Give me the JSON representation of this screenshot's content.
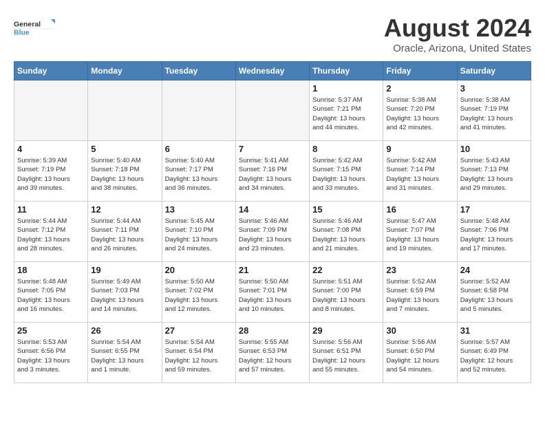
{
  "header": {
    "logo_line1": "General",
    "logo_line2": "Blue",
    "title": "August 2024",
    "subtitle": "Oracle, Arizona, United States"
  },
  "weekdays": [
    "Sunday",
    "Monday",
    "Tuesday",
    "Wednesday",
    "Thursday",
    "Friday",
    "Saturday"
  ],
  "weeks": [
    [
      {
        "day": "",
        "info": ""
      },
      {
        "day": "",
        "info": ""
      },
      {
        "day": "",
        "info": ""
      },
      {
        "day": "",
        "info": ""
      },
      {
        "day": "1",
        "info": "Sunrise: 5:37 AM\nSunset: 7:21 PM\nDaylight: 13 hours\nand 44 minutes."
      },
      {
        "day": "2",
        "info": "Sunrise: 5:38 AM\nSunset: 7:20 PM\nDaylight: 13 hours\nand 42 minutes."
      },
      {
        "day": "3",
        "info": "Sunrise: 5:38 AM\nSunset: 7:19 PM\nDaylight: 13 hours\nand 41 minutes."
      }
    ],
    [
      {
        "day": "4",
        "info": "Sunrise: 5:39 AM\nSunset: 7:19 PM\nDaylight: 13 hours\nand 39 minutes."
      },
      {
        "day": "5",
        "info": "Sunrise: 5:40 AM\nSunset: 7:18 PM\nDaylight: 13 hours\nand 38 minutes."
      },
      {
        "day": "6",
        "info": "Sunrise: 5:40 AM\nSunset: 7:17 PM\nDaylight: 13 hours\nand 36 minutes."
      },
      {
        "day": "7",
        "info": "Sunrise: 5:41 AM\nSunset: 7:16 PM\nDaylight: 13 hours\nand 34 minutes."
      },
      {
        "day": "8",
        "info": "Sunrise: 5:42 AM\nSunset: 7:15 PM\nDaylight: 13 hours\nand 33 minutes."
      },
      {
        "day": "9",
        "info": "Sunrise: 5:42 AM\nSunset: 7:14 PM\nDaylight: 13 hours\nand 31 minutes."
      },
      {
        "day": "10",
        "info": "Sunrise: 5:43 AM\nSunset: 7:13 PM\nDaylight: 13 hours\nand 29 minutes."
      }
    ],
    [
      {
        "day": "11",
        "info": "Sunrise: 5:44 AM\nSunset: 7:12 PM\nDaylight: 13 hours\nand 28 minutes."
      },
      {
        "day": "12",
        "info": "Sunrise: 5:44 AM\nSunset: 7:11 PM\nDaylight: 13 hours\nand 26 minutes."
      },
      {
        "day": "13",
        "info": "Sunrise: 5:45 AM\nSunset: 7:10 PM\nDaylight: 13 hours\nand 24 minutes."
      },
      {
        "day": "14",
        "info": "Sunrise: 5:46 AM\nSunset: 7:09 PM\nDaylight: 13 hours\nand 23 minutes."
      },
      {
        "day": "15",
        "info": "Sunrise: 5:46 AM\nSunset: 7:08 PM\nDaylight: 13 hours\nand 21 minutes."
      },
      {
        "day": "16",
        "info": "Sunrise: 5:47 AM\nSunset: 7:07 PM\nDaylight: 13 hours\nand 19 minutes."
      },
      {
        "day": "17",
        "info": "Sunrise: 5:48 AM\nSunset: 7:06 PM\nDaylight: 13 hours\nand 17 minutes."
      }
    ],
    [
      {
        "day": "18",
        "info": "Sunrise: 5:48 AM\nSunset: 7:05 PM\nDaylight: 13 hours\nand 16 minutes."
      },
      {
        "day": "19",
        "info": "Sunrise: 5:49 AM\nSunset: 7:03 PM\nDaylight: 13 hours\nand 14 minutes."
      },
      {
        "day": "20",
        "info": "Sunrise: 5:50 AM\nSunset: 7:02 PM\nDaylight: 13 hours\nand 12 minutes."
      },
      {
        "day": "21",
        "info": "Sunrise: 5:50 AM\nSunset: 7:01 PM\nDaylight: 13 hours\nand 10 minutes."
      },
      {
        "day": "22",
        "info": "Sunrise: 5:51 AM\nSunset: 7:00 PM\nDaylight: 13 hours\nand 8 minutes."
      },
      {
        "day": "23",
        "info": "Sunrise: 5:52 AM\nSunset: 6:59 PM\nDaylight: 13 hours\nand 7 minutes."
      },
      {
        "day": "24",
        "info": "Sunrise: 5:52 AM\nSunset: 6:58 PM\nDaylight: 13 hours\nand 5 minutes."
      }
    ],
    [
      {
        "day": "25",
        "info": "Sunrise: 5:53 AM\nSunset: 6:56 PM\nDaylight: 13 hours\nand 3 minutes."
      },
      {
        "day": "26",
        "info": "Sunrise: 5:54 AM\nSunset: 6:55 PM\nDaylight: 13 hours\nand 1 minute."
      },
      {
        "day": "27",
        "info": "Sunrise: 5:54 AM\nSunset: 6:54 PM\nDaylight: 12 hours\nand 59 minutes."
      },
      {
        "day": "28",
        "info": "Sunrise: 5:55 AM\nSunset: 6:53 PM\nDaylight: 12 hours\nand 57 minutes."
      },
      {
        "day": "29",
        "info": "Sunrise: 5:56 AM\nSunset: 6:51 PM\nDaylight: 12 hours\nand 55 minutes."
      },
      {
        "day": "30",
        "info": "Sunrise: 5:56 AM\nSunset: 6:50 PM\nDaylight: 12 hours\nand 54 minutes."
      },
      {
        "day": "31",
        "info": "Sunrise: 5:57 AM\nSunset: 6:49 PM\nDaylight: 12 hours\nand 52 minutes."
      }
    ]
  ]
}
